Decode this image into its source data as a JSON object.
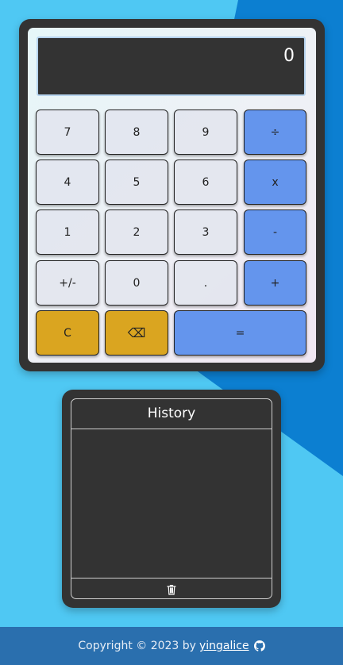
{
  "display": {
    "value": "0"
  },
  "keys": {
    "seven": "7",
    "eight": "8",
    "nine": "9",
    "divide": "÷",
    "four": "4",
    "five": "5",
    "six": "6",
    "multiply": "x",
    "one": "1",
    "two": "2",
    "three": "3",
    "subtract": "-",
    "negate": "+/-",
    "zero": "0",
    "decimal": ".",
    "add": "+",
    "clear": "C",
    "backspace": "⌫",
    "equals": "="
  },
  "history": {
    "title": "History",
    "entries": []
  },
  "footer": {
    "copyright": "Copyright © 2023 by",
    "author": "yingalice"
  },
  "colors": {
    "background": "#4fc8f3",
    "background_dark": "#0c7fd1",
    "operator": "#6495ed",
    "function": "#daa520",
    "frame": "#333333",
    "footer": "#2a6fae"
  },
  "icons": {
    "trash": "trash-icon",
    "github": "github-icon"
  }
}
